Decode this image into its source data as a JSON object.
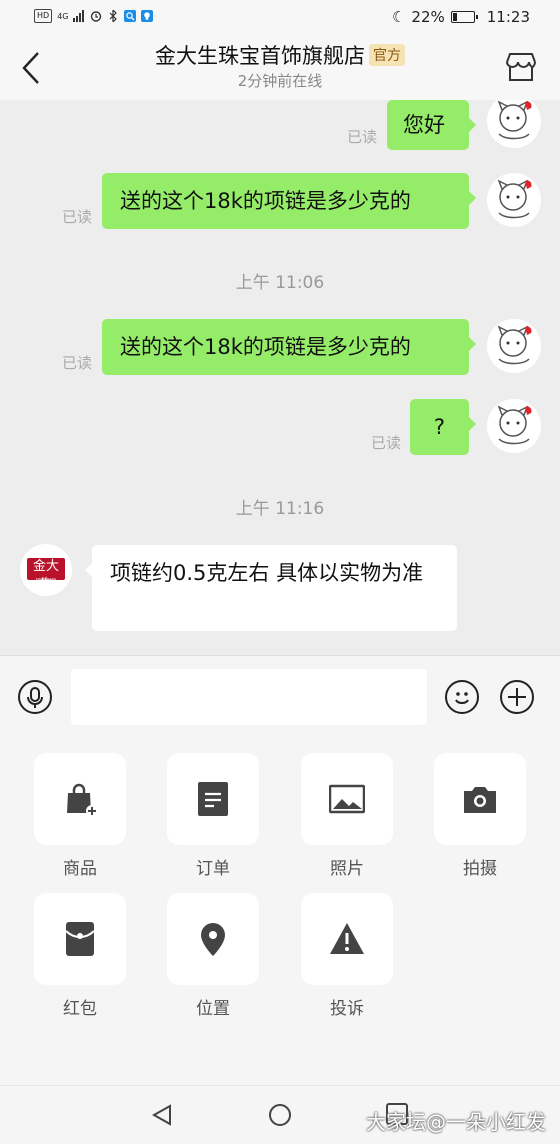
{
  "status_bar": {
    "left_chips": [
      "HD",
      "4G"
    ],
    "moon": "☾",
    "battery_percent_text": "22%",
    "battery_level": 0.22,
    "time": "11:23"
  },
  "header": {
    "title": "金大生珠宝首饰旗舰店",
    "badge": "官方",
    "subtitle": "2分钟前在线"
  },
  "chat": {
    "messages": [
      {
        "side": "me",
        "text": "您好",
        "read": "已读"
      },
      {
        "side": "me",
        "text": "送的这个18k的项链是多少克的",
        "read": "已读"
      },
      {
        "type": "time",
        "text": "上午 11:06"
      },
      {
        "side": "me",
        "text": "送的这个18k的项链是多少克的",
        "read": "已读"
      },
      {
        "side": "me",
        "text": "?",
        "read": "已读"
      },
      {
        "type": "time",
        "text": "上午 11:16"
      },
      {
        "side": "shop",
        "text": "项链约0.5克左右 具体以实物为准"
      }
    ],
    "shop_logo_text": "金大生",
    "shop_logo_sub": "KINGTAISANG"
  },
  "input": {
    "placeholder": ""
  },
  "panel": {
    "items": [
      {
        "label": "商品",
        "icon": "shopping-bag-icon"
      },
      {
        "label": "订单",
        "icon": "order-document-icon"
      },
      {
        "label": "照片",
        "icon": "photo-icon"
      },
      {
        "label": "拍摄",
        "icon": "camera-icon"
      },
      {
        "label": "红包",
        "icon": "red-packet-icon"
      },
      {
        "label": "位置",
        "icon": "location-pin-icon"
      },
      {
        "label": "投诉",
        "icon": "warning-icon"
      }
    ]
  },
  "watermark": "大家坛@一朵小红发"
}
